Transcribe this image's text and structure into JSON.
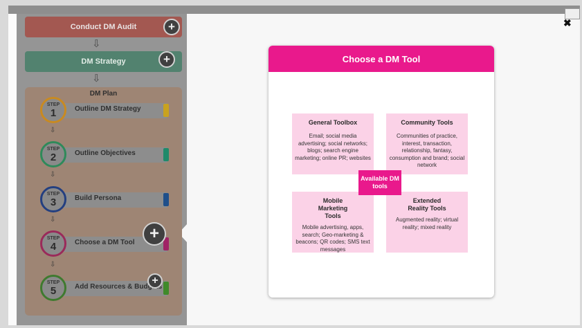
{
  "flow": {
    "audit_label": "Conduct DM Audit",
    "strategy_label": "DM Strategy",
    "plan_title": "DM Plan",
    "plus_glyph": "+",
    "arrow_glyph": "⇩",
    "small_arrow_glyph": "⇩",
    "steps": [
      {
        "step_word": "STEP",
        "number": "1",
        "label": "Outline DM Strategy",
        "ring": "#c98a20",
        "tab": "#c9a21e"
      },
      {
        "step_word": "STEP",
        "number": "2",
        "label": "Outline Objectives",
        "ring": "#2f8a5a",
        "tab": "#1f8a6a"
      },
      {
        "step_word": "STEP",
        "number": "3",
        "label": "Build Persona",
        "ring": "#233f80",
        "tab": "#1f4f8a"
      },
      {
        "step_word": "STEP",
        "number": "4",
        "label": "Choose a DM Tool",
        "ring": "#9a2a5a",
        "tab": "#a02366"
      },
      {
        "step_word": "STEP",
        "number": "5",
        "label": "Add Resources & Budgets",
        "ring": "#3f7a2f",
        "tab": "#3f8a2a"
      }
    ]
  },
  "close": {
    "glyph": "✖"
  },
  "card": {
    "title": "Choose a DM Tool",
    "center_label": "Available DM tools",
    "tiles": [
      {
        "title": "General Toolbox",
        "desc": "Email; social media advertising; social networks; blogs; search engine marketing; online PR; websites"
      },
      {
        "title": "Community Tools",
        "desc": "Communities of practice, interest, transaction, relationship, fantasy, consumption and brand; social network"
      },
      {
        "title": "Mobile Marketing Tools",
        "desc": "Mobile advertising, apps, search; Geo-marketing & beacons; QR codes; SMS text messages"
      },
      {
        "title": "Extended Reality Tools",
        "desc": "Augmented reality; virtual reality; mixed reality"
      }
    ]
  },
  "colors": {
    "accent": "#e9198c",
    "tile": "#fbd2e7"
  }
}
